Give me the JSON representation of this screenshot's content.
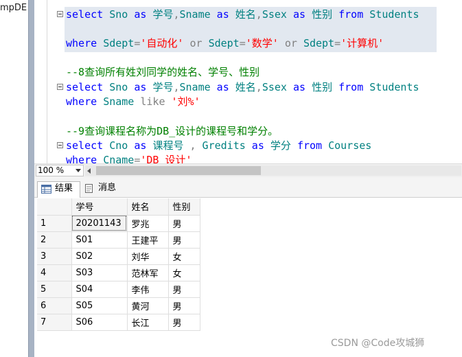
{
  "left_panel": {
    "text": "mpDE"
  },
  "editor": {
    "lines": [
      {
        "id": "l1",
        "tokens": [
          [
            "kw",
            "select"
          ],
          [
            "",
            " "
          ],
          [
            "id",
            "Sno"
          ],
          [
            "",
            " "
          ],
          [
            "kw",
            "as"
          ],
          [
            "",
            " "
          ],
          [
            "id",
            "学号"
          ],
          [
            "gr",
            ","
          ],
          [
            "id",
            "Sname"
          ],
          [
            "",
            " "
          ],
          [
            "kw",
            "as"
          ],
          [
            "",
            " "
          ],
          [
            "id",
            "姓名"
          ],
          [
            "gr",
            ","
          ],
          [
            "id",
            "Ssex"
          ],
          [
            "",
            " "
          ],
          [
            "kw",
            "as"
          ],
          [
            "",
            " "
          ],
          [
            "id",
            "性别"
          ],
          [
            "",
            " "
          ],
          [
            "kw",
            "from"
          ],
          [
            "",
            " "
          ],
          [
            "id",
            "Students"
          ]
        ]
      },
      {
        "id": "l2",
        "tokens": [
          [
            "kw",
            "where"
          ],
          [
            "",
            " "
          ],
          [
            "id",
            "Sdept"
          ],
          [
            "gr",
            "="
          ],
          [
            "str",
            "'自动化'"
          ],
          [
            "",
            " "
          ],
          [
            "gr",
            "or"
          ],
          [
            "",
            " "
          ],
          [
            "id",
            "Sdept"
          ],
          [
            "gr",
            "="
          ],
          [
            "str",
            "'数学'"
          ],
          [
            "",
            " "
          ],
          [
            "gr",
            "or"
          ],
          [
            "",
            " "
          ],
          [
            "id",
            "Sdept"
          ],
          [
            "gr",
            "="
          ],
          [
            "str",
            "'计算机'"
          ]
        ]
      },
      {
        "id": "l3",
        "tokens": [
          [
            "cm",
            "--8查询所有姓刘同学的姓名、学号、性别"
          ]
        ]
      },
      {
        "id": "l4",
        "tokens": [
          [
            "kw",
            "select"
          ],
          [
            "",
            " "
          ],
          [
            "id",
            "Sno"
          ],
          [
            "",
            " "
          ],
          [
            "kw",
            "as"
          ],
          [
            "",
            " "
          ],
          [
            "id",
            "学号"
          ],
          [
            "gr",
            ","
          ],
          [
            "id",
            "Sname"
          ],
          [
            "",
            " "
          ],
          [
            "kw",
            "as"
          ],
          [
            "",
            " "
          ],
          [
            "id",
            "姓名"
          ],
          [
            "gr",
            ","
          ],
          [
            "id",
            "Ssex"
          ],
          [
            "",
            " "
          ],
          [
            "kw",
            "as"
          ],
          [
            "",
            " "
          ],
          [
            "id",
            "性别"
          ],
          [
            "",
            " "
          ],
          [
            "kw",
            "from"
          ],
          [
            "",
            " "
          ],
          [
            "id",
            "Students"
          ]
        ]
      },
      {
        "id": "l5",
        "tokens": [
          [
            "kw",
            "where"
          ],
          [
            "",
            " "
          ],
          [
            "id",
            "Sname"
          ],
          [
            "",
            " "
          ],
          [
            "gr",
            "like"
          ],
          [
            "",
            " "
          ],
          [
            "str",
            "'刘%'"
          ]
        ]
      },
      {
        "id": "l6",
        "tokens": [
          [
            "cm",
            "--9查询课程名称为DB_设计的课程号和学分。"
          ]
        ]
      },
      {
        "id": "l7",
        "tokens": [
          [
            "kw",
            "select"
          ],
          [
            "",
            " "
          ],
          [
            "id",
            "Cno"
          ],
          [
            "",
            " "
          ],
          [
            "kw",
            "as"
          ],
          [
            "",
            " "
          ],
          [
            "id",
            "课程号"
          ],
          [
            "",
            " "
          ],
          [
            "gr",
            ","
          ],
          [
            "",
            " "
          ],
          [
            "id",
            "Gredits"
          ],
          [
            "",
            " "
          ],
          [
            "kw",
            "as"
          ],
          [
            "",
            " "
          ],
          [
            "id",
            "学分"
          ],
          [
            "",
            " "
          ],
          [
            "kw",
            "from"
          ],
          [
            "",
            " "
          ],
          [
            "id",
            "Courses"
          ]
        ]
      },
      {
        "id": "l8",
        "tokens": [
          [
            "kw",
            "where"
          ],
          [
            "",
            " "
          ],
          [
            "id",
            "Cname"
          ],
          [
            "gr",
            "="
          ],
          [
            "str",
            "'DB_设计'"
          ]
        ]
      }
    ]
  },
  "zoom": {
    "value": "100 %"
  },
  "tabs": {
    "results": "结果",
    "messages": "消息"
  },
  "grid": {
    "columns": [
      "学号",
      "姓名",
      "性别"
    ],
    "rows": [
      [
        "1",
        "20201143",
        "罗兆",
        "男"
      ],
      [
        "2",
        "S01",
        "王建平",
        "男"
      ],
      [
        "3",
        "S02",
        "刘华",
        "女"
      ],
      [
        "4",
        "S03",
        "范林军",
        "女"
      ],
      [
        "5",
        "S04",
        "李伟",
        "男"
      ],
      [
        "6",
        "S05",
        "黄河",
        "男"
      ],
      [
        "7",
        "S06",
        "长江",
        "男"
      ]
    ]
  },
  "watermark": "CSDN @Code攻城狮",
  "colors": {
    "keyword": "#0000ff",
    "identifier": "#008080",
    "string": "#ff0000",
    "comment": "#008000",
    "operator": "#808080"
  }
}
